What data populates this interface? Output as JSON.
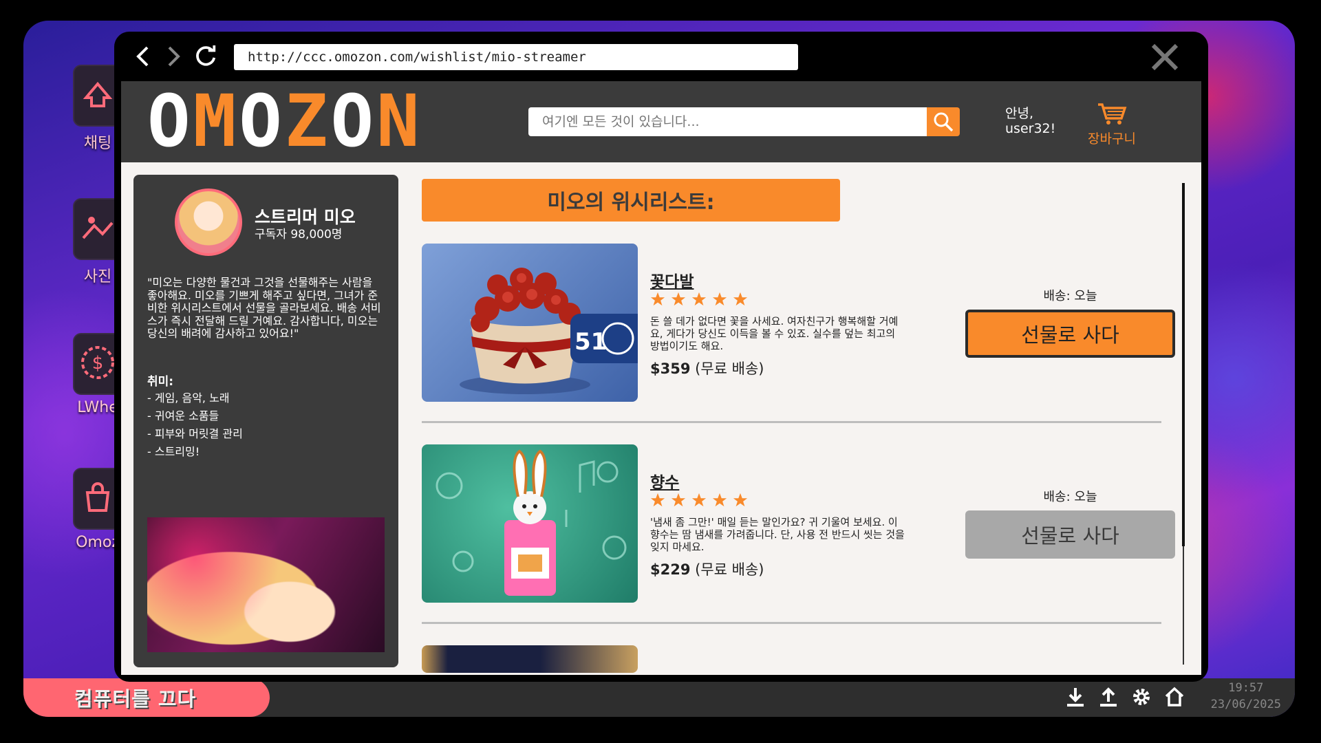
{
  "desktop": {
    "icons": [
      {
        "label": "채팅",
        "icon": "chat-icon"
      },
      {
        "label": "사진",
        "icon": "photo-icon"
      },
      {
        "label": "LWhe",
        "icon": "casino-chip-icon"
      },
      {
        "label": "Omoz",
        "icon": "shopping-bag-icon"
      }
    ]
  },
  "taskbar": {
    "shutdown_label": "컴퓨터를 끄다",
    "time": "19:57",
    "date": "23/06/2025"
  },
  "browser": {
    "url": "http://ccc.omozon.com/wishlist/mio-streamer"
  },
  "site": {
    "logo_letters": [
      "O",
      "M",
      "O",
      "Z",
      "O",
      "N"
    ],
    "logo_colors": [
      "#ffffff",
      "#f98a2b",
      "#ffffff",
      "#f98a2b",
      "#ffffff",
      "#f98a2b"
    ],
    "search_placeholder": "여기엔 모든 것이 있습니다...",
    "greeting_line1": "안녕,",
    "greeting_line2": "user32!",
    "cart_label": "장바구니",
    "accent": "#f98a2b"
  },
  "profile": {
    "name": "스트리머 미오",
    "subscribers": "구독자 98,000명",
    "quote": "\"미오는 다양한 물건과 그것을 선물해주는 사람을 좋아해요. 미오를 기쁘게 해주고 싶다면, 그녀가 준비한 위시리스트에서 선물을 골라보세요. 배송 서비스가 즉시 전달해 드릴 거예요. 감사합니다, 미오는 당신의 배려에 감사하고 있어요!\"",
    "hobbies_title": "취미:",
    "hobbies": [
      "- 게임, 음악, 노래",
      "- 귀여운 소품들",
      "- 피부와 머릿결 관리",
      "- 스트리밍!"
    ]
  },
  "wishlist": {
    "title": "미오의 위시리스트:",
    "items": [
      {
        "name": "꽃다발",
        "rating": 5,
        "description": "돈 쓸 데가 없다면 꽃을 사세요. 여자친구가 행복해할 거예요, 게다가 당신도 이득을 볼 수 있죠. 실수를 덮는 최고의 방법이기도 해요.",
        "price": "$359",
        "shipping_note": "(무료 배송)",
        "delivery": "배송: 오늘",
        "buy_label": "선물로 사다",
        "badge": "51"
      },
      {
        "name": "향수",
        "rating": 5,
        "description": "'냄새 좀 그만!' 매일 듣는 말인가요? 귀 기울여 보세요. 이 향수는 땀 냄새를 가려줍니다. 단, 사용 전 반드시 씻는 것을 잊지 마세요.",
        "price": "$229",
        "shipping_note": "(무료 배송)",
        "delivery": "배송: 오늘",
        "buy_label": "선물로 사다"
      }
    ]
  }
}
